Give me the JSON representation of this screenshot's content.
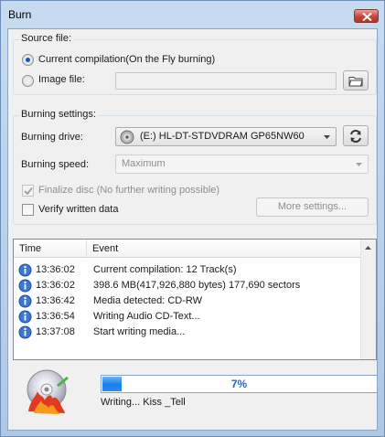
{
  "window": {
    "title": "Burn"
  },
  "source": {
    "group_label": "Source file:",
    "current_compilation_label": "Current compilation(On the Fly burning)",
    "image_file_label": "Image file:",
    "image_file_value": "",
    "selected": "current_compilation"
  },
  "burning": {
    "group_label": "Burning settings:",
    "drive_label": "Burning drive:",
    "drive_value": "(E:) HL-DT-STDVDRAM GP65NW60",
    "speed_label": "Burning speed:",
    "speed_value": "Maximum",
    "finalize_label": "Finalize disc (No further writing possible)",
    "finalize_checked": true,
    "verify_label": "Verify written data",
    "verify_checked": false,
    "more_settings_label": "More settings..."
  },
  "log": {
    "columns": {
      "time": "Time",
      "event": "Event"
    },
    "rows": [
      {
        "time": "13:36:02",
        "event": "Current compilation: 12 Track(s)"
      },
      {
        "time": "13:36:02",
        "event": "398.6 MB(417,926,880 bytes)  177,690 sectors"
      },
      {
        "time": "13:36:42",
        "event": "Media detected: CD-RW"
      },
      {
        "time": "13:36:54",
        "event": "Writing Audio CD-Text..."
      },
      {
        "time": "13:37:08",
        "event": "Start writing media..."
      }
    ]
  },
  "progress": {
    "percent": 7,
    "label": "7%",
    "status": "Writing... Kiss _Tell"
  },
  "icons": {
    "close": "close-icon",
    "folder": "folder-icon",
    "refresh": "refresh-icon",
    "drive": "disc-drive-icon",
    "info": "info-icon",
    "disc": "burning-disc-icon"
  },
  "colors": {
    "accent": "#1a7de6",
    "progress_text": "#2a64b8"
  }
}
